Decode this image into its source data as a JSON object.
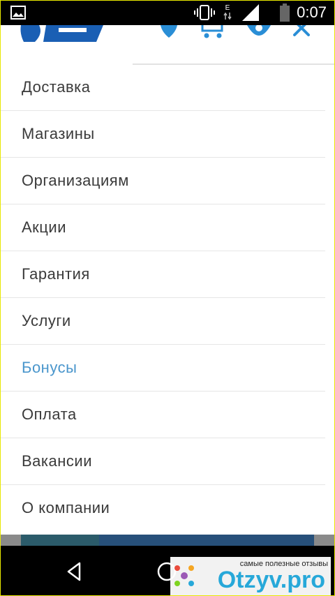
{
  "status_bar": {
    "time": "0:07",
    "network_label": "E",
    "icons": [
      "image-notification-icon",
      "vibrate-icon",
      "data-arrows-icon",
      "signal-icon",
      "battery-icon"
    ]
  },
  "header": {
    "icons": [
      "location-pin-icon",
      "cart-icon",
      "user-icon",
      "close-icon"
    ],
    "accent_color": "#1a5fb4"
  },
  "menu": {
    "items": [
      {
        "label": "Доставка",
        "active": false
      },
      {
        "label": "Магазины",
        "active": false
      },
      {
        "label": "Организациям",
        "active": false
      },
      {
        "label": "Акции",
        "active": false
      },
      {
        "label": "Гарантия",
        "active": false
      },
      {
        "label": "Услуги",
        "active": false
      },
      {
        "label": "Бонусы",
        "active": true
      },
      {
        "label": "Оплата",
        "active": false
      },
      {
        "label": "Вакансии",
        "active": false
      },
      {
        "label": "О компании",
        "active": false
      }
    ],
    "active_color": "#4a96cc"
  },
  "nav_bar": {
    "icons": [
      "back-icon",
      "home-icon"
    ]
  },
  "watermark": {
    "tagline": "самые полезные отзывы",
    "brand": "Otzyv.pro"
  }
}
